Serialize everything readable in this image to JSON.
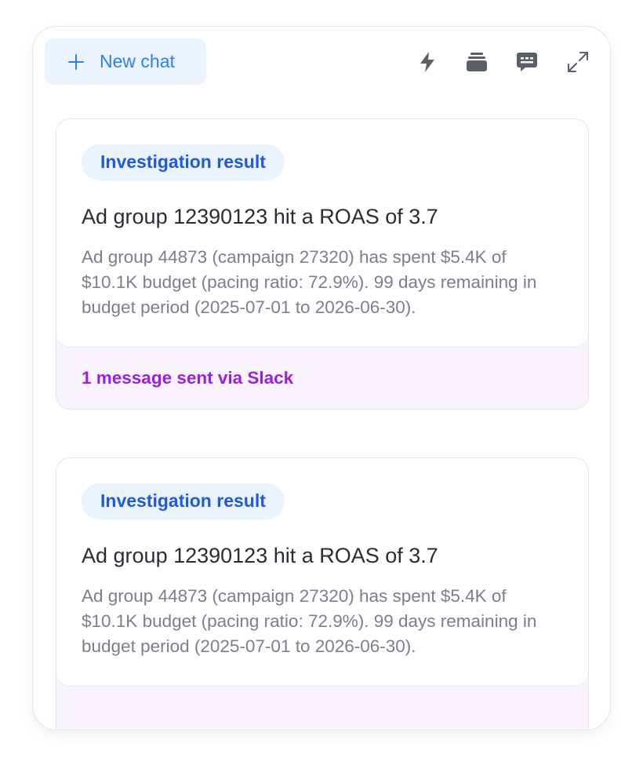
{
  "header": {
    "new_chat_label": "New chat",
    "tools": [
      {
        "icon": "lightning-icon"
      },
      {
        "icon": "stack-icon"
      },
      {
        "icon": "chat-bubble-icon"
      },
      {
        "icon": "expand-icon"
      }
    ]
  },
  "cards": [
    {
      "badge": "Investigation result",
      "title": "Ad group 12390123 hit a ROAS of 3.7",
      "body": "Ad group 44873 (campaign 27320) has spent $5.4K of $10.1K budget (pacing ratio: 72.9%). 99 days remaining in budget period (2025-07-01 to 2026-06-30).",
      "footer": "1 message sent via Slack"
    },
    {
      "badge": "Investigation result",
      "title": "Ad group 12390123 hit a ROAS of 3.7",
      "body": "Ad group 44873 (campaign 27320) has spent $5.4K of $10.1K budget (pacing ratio: 72.9%). 99 days remaining in budget period (2025-07-01 to 2026-06-30)."
    }
  ],
  "colors": {
    "accent_blue": "#2f80ed",
    "badge_text": "#1f5bd6",
    "slack_purple": "#9b1fe0",
    "footer_bg": "#f8f3fd"
  }
}
